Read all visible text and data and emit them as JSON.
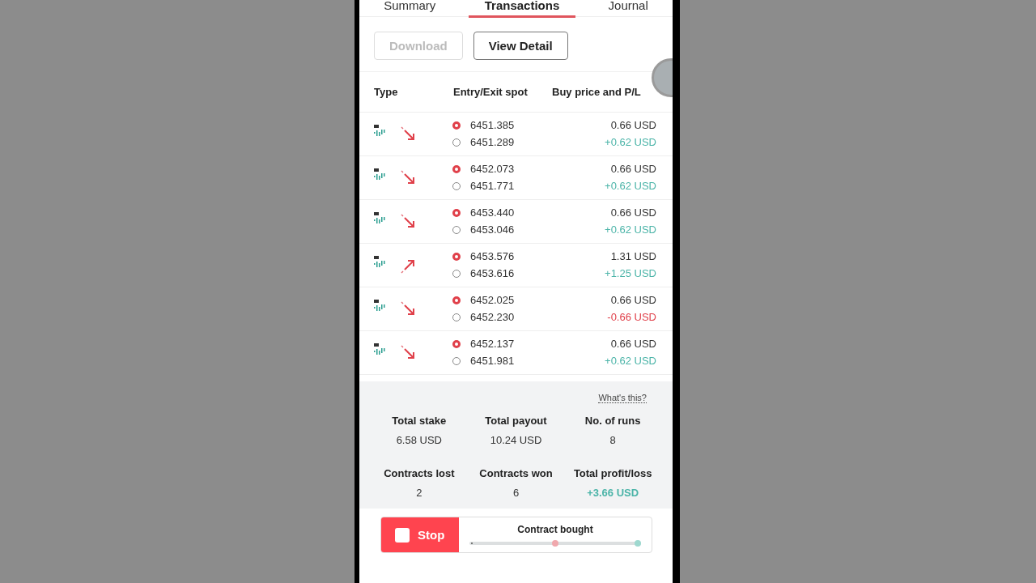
{
  "tabs": [
    {
      "label": "Summary",
      "selected": false
    },
    {
      "label": "Transactions",
      "selected": true
    },
    {
      "label": "Journal",
      "selected": false
    }
  ],
  "actions": [
    {
      "label": "Download",
      "disabled": true
    },
    {
      "label": "View Detail",
      "disabled": false
    }
  ],
  "table": {
    "columns": [
      "Type",
      "Entry/Exit spot",
      "Buy price and P/L"
    ],
    "rows": [
      {
        "kind": "down",
        "entry": "6451.385",
        "exit": "6451.289",
        "buy_price": "0.66 USD",
        "pl": "+0.62 USD",
        "loss": false
      },
      {
        "kind": "down",
        "entry": "6452.073",
        "exit": "6451.771",
        "buy_price": "0.66 USD",
        "pl": "+0.62 USD",
        "loss": false
      },
      {
        "kind": "down",
        "entry": "6453.440",
        "exit": "6453.046",
        "buy_price": "0.66 USD",
        "pl": "+0.62 USD",
        "loss": false
      },
      {
        "kind": "up",
        "entry": "6453.576",
        "exit": "6453.616",
        "buy_price": "1.31 USD",
        "pl": "+1.25 USD",
        "loss": false
      },
      {
        "kind": "down",
        "entry": "6452.025",
        "exit": "6452.230",
        "buy_price": "0.66 USD",
        "pl": "-0.66 USD",
        "loss": true
      },
      {
        "kind": "down",
        "entry": "6452.137",
        "exit": "6451.981",
        "buy_price": "0.66 USD",
        "pl": "+0.62 USD",
        "loss": false
      }
    ]
  },
  "summary": {
    "help_link": "What's this?",
    "stats": [
      {
        "label": "Total stake",
        "value": "6.58 USD",
        "highlighted": false
      },
      {
        "label": "Total payout",
        "value": "10.24 USD",
        "highlighted": false
      },
      {
        "label": "No. of runs",
        "value": "8",
        "highlighted": false
      },
      {
        "label": "Contracts lost",
        "value": "2",
        "highlighted": false
      },
      {
        "label": "Contracts won",
        "value": "6",
        "highlighted": false
      },
      {
        "label": "Total profit/loss",
        "value": "+3.66 USD",
        "highlighted": true
      }
    ]
  },
  "footer": {
    "stop_label": "Stop",
    "status": "Contract bought"
  }
}
